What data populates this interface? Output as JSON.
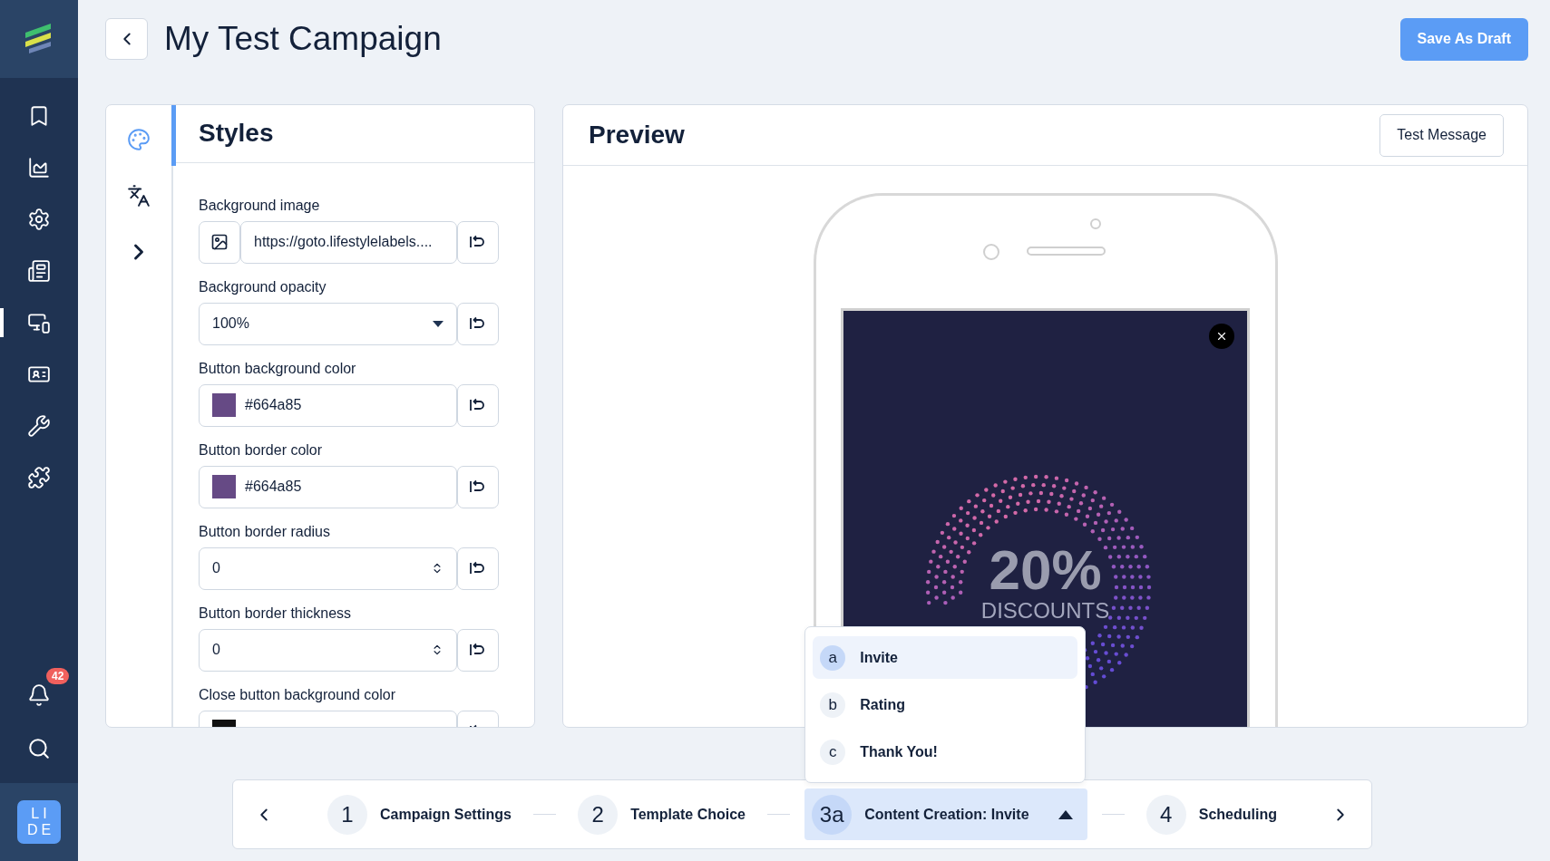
{
  "sidebar": {
    "items": [
      {
        "selected": false
      },
      {
        "selected": false
      },
      {
        "selected": false
      },
      {
        "selected": false
      },
      {
        "selected": true
      },
      {
        "selected": false
      },
      {
        "selected": false
      },
      {
        "selected": false
      }
    ],
    "notifications": {
      "badge": "42"
    },
    "avatar": {
      "initials": "LI DE"
    }
  },
  "header": {
    "title": "My Test Campaign",
    "save_button": "Save As Draft"
  },
  "styles_panel": {
    "title": "Styles",
    "side_tabs": [
      {
        "selected": true
      },
      {
        "selected": false
      },
      {
        "selected": false
      }
    ],
    "fields": [
      {
        "kind": "image",
        "label": "Background image",
        "value": "https://goto.lifestylelabels...."
      },
      {
        "kind": "select",
        "label": "Background opacity",
        "value": "100%"
      },
      {
        "kind": "color",
        "label": "Button background color",
        "value": "#664a85",
        "color": "#664a85"
      },
      {
        "kind": "color",
        "label": "Button border color",
        "value": "#664a85",
        "color": "#664a85"
      },
      {
        "kind": "number",
        "label": "Button border radius",
        "value": "0"
      },
      {
        "kind": "number",
        "label": "Button border thickness",
        "value": "0"
      },
      {
        "kind": "color",
        "label": "Close button background color",
        "color": "#111111"
      }
    ]
  },
  "preview": {
    "title": "Preview",
    "test_button": "Test Message",
    "popup": {
      "headline": "20%",
      "subline": "DISCOUNTS"
    }
  },
  "stepper": {
    "steps": [
      {
        "number": "1",
        "label": "Campaign Settings",
        "selected": false
      },
      {
        "number": "2",
        "label": "Template Choice",
        "selected": false
      },
      {
        "number": "3a",
        "label": "Content Creation: Invite",
        "selected": true,
        "expanded": true
      },
      {
        "number": "4",
        "label": "Scheduling",
        "selected": false
      }
    ],
    "substeps": [
      {
        "letter": "a",
        "label": "Invite",
        "selected": true
      },
      {
        "letter": "b",
        "label": "Rating",
        "selected": false
      },
      {
        "letter": "c",
        "label": "Thank You!",
        "selected": false
      }
    ]
  }
}
